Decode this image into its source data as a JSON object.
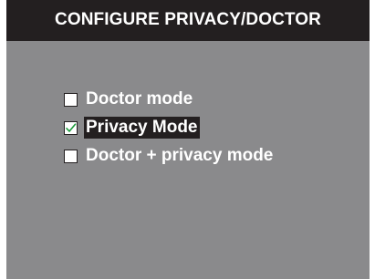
{
  "title": "CONFIGURE PRIVACY/DOCTOR",
  "options": [
    {
      "label": "Doctor mode",
      "checked": false,
      "selected": false
    },
    {
      "label": "Privacy Mode",
      "checked": true,
      "selected": true
    },
    {
      "label": "Doctor + privacy mode",
      "checked": false,
      "selected": false
    }
  ],
  "colors": {
    "screen_background": "#8a8a8c",
    "title_bar": "#231f20",
    "text": "#ffffff",
    "selection_highlight": "#231f20",
    "checkmark": "#1a9a3a"
  }
}
